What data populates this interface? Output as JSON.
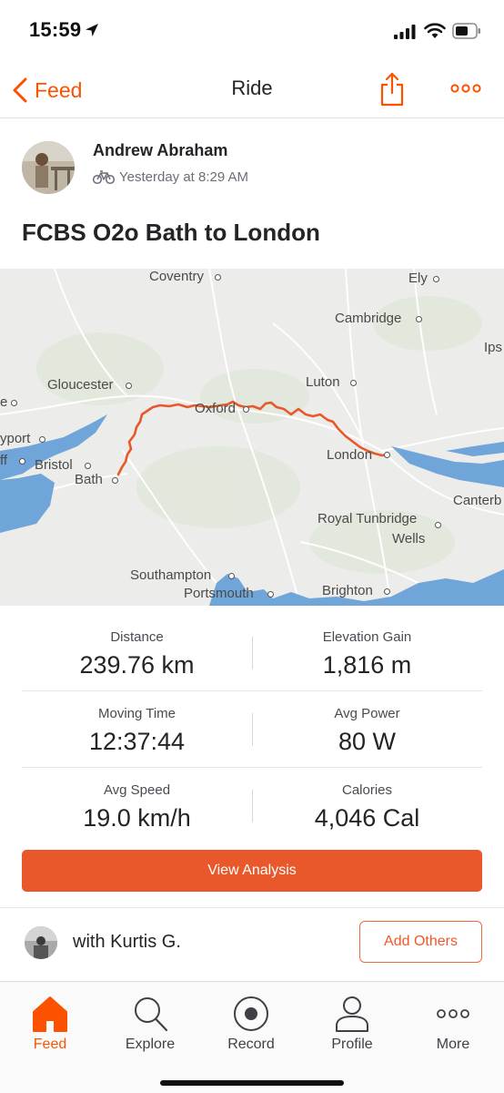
{
  "status_bar": {
    "time": "15:59",
    "icons": [
      "location-arrow-icon",
      "signal-icon",
      "wifi-icon",
      "battery-icon"
    ]
  },
  "nav": {
    "back_label": "Feed",
    "title": "Ride",
    "actions": [
      "share-icon",
      "more-icon"
    ]
  },
  "athlete": {
    "name": "Andrew Abraham",
    "activity_icon": "bike-icon",
    "time": "Yesterday at 8:29 AM"
  },
  "activity": {
    "title": "FCBS O2o Bath to London"
  },
  "map": {
    "labels": {
      "coventry": "Coventry",
      "ely": "Ely",
      "cambridge": "Cambridge",
      "ips": "Ips",
      "gloucester": "Gloucester",
      "luton": "Luton",
      "oxford": "Oxford",
      "e": "e",
      "yport": "yport",
      "ff": "ff",
      "bristol": "Bristol",
      "bath": "Bath",
      "london": "London",
      "canterb": "Canterb",
      "royal_tunbridge": "Royal Tunbridge",
      "wells": "Wells",
      "southampton": "Southampton",
      "portsmouth": "Portsmouth",
      "brighton": "Brighton"
    },
    "route_color": "#e8582a",
    "water_color": "#5b9bd5"
  },
  "stats": {
    "distance": {
      "label": "Distance",
      "value": "239.76 km"
    },
    "elevation": {
      "label": "Elevation Gain",
      "value": "1,816 m"
    },
    "moving_time": {
      "label": "Moving Time",
      "value": "12:37:44"
    },
    "avg_power": {
      "label": "Avg Power",
      "value": "80 W"
    },
    "avg_speed": {
      "label": "Avg Speed",
      "value": "19.0 km/h"
    },
    "calories": {
      "label": "Calories",
      "value": "4,046 Cal"
    }
  },
  "analysis_button": "View Analysis",
  "with": {
    "label": "with Kurtis G.",
    "add_others": "Add Others"
  },
  "tabs": [
    {
      "label": "Feed",
      "icon": "home-icon",
      "active": true
    },
    {
      "label": "Explore",
      "icon": "search-icon",
      "active": false
    },
    {
      "label": "Record",
      "icon": "record-icon",
      "active": false
    },
    {
      "label": "Profile",
      "icon": "profile-icon",
      "active": false
    },
    {
      "label": "More",
      "icon": "more-icon",
      "active": false
    }
  ],
  "colors": {
    "accent": "#fc5200",
    "button": "#e8582a"
  }
}
